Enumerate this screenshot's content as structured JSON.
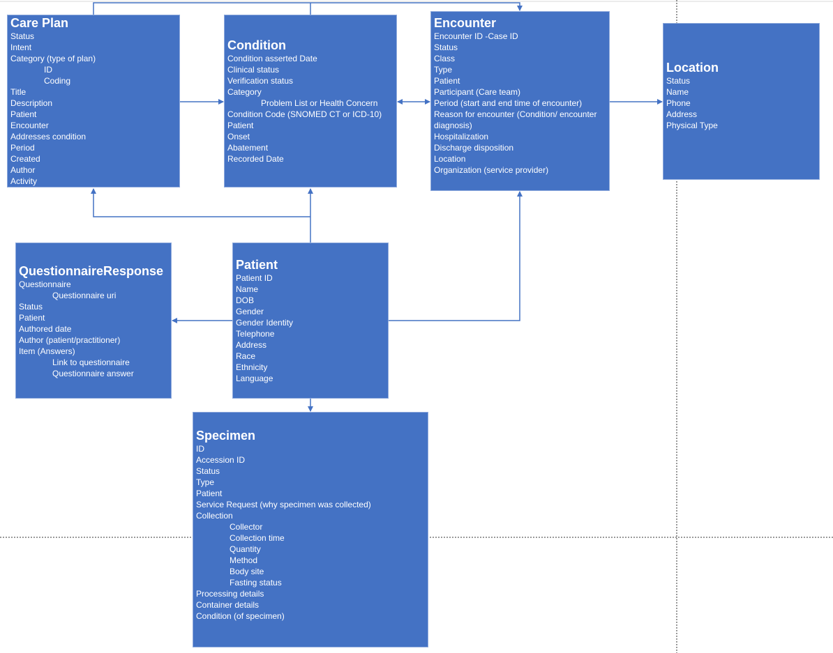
{
  "colors": {
    "box_fill": "#4472c4",
    "connector": "#4472c4"
  },
  "boxes": {
    "care_plan": {
      "title": "Care Plan",
      "items": [
        {
          "t": "Status"
        },
        {
          "t": "Intent"
        },
        {
          "t": "Category (type of plan)"
        },
        {
          "t": "ID",
          "sub": true
        },
        {
          "t": "Coding",
          "sub": true
        },
        {
          "t": "Title"
        },
        {
          "t": "Description"
        },
        {
          "t": "Patient"
        },
        {
          "t": "Encounter"
        },
        {
          "t": "Addresses condition"
        },
        {
          "t": "Period"
        },
        {
          "t": "Created"
        },
        {
          "t": "Author"
        },
        {
          "t": "Activity"
        }
      ]
    },
    "condition": {
      "title": "Condition",
      "items": [
        {
          "t": "Condition asserted Date"
        },
        {
          "t": "Clinical status"
        },
        {
          "t": "Verification status"
        },
        {
          "t": "Category"
        },
        {
          "t": "Problem List or Health Concern",
          "sub": true
        },
        {
          "t": "Condition Code (SNOMED CT or ICD-10)"
        },
        {
          "t": "Patient"
        },
        {
          "t": "Onset"
        },
        {
          "t": "Abatement"
        },
        {
          "t": "Recorded Date"
        }
      ]
    },
    "encounter": {
      "title": "Encounter",
      "items": [
        {
          "t": "Encounter ID -Case ID"
        },
        {
          "t": "Status"
        },
        {
          "t": "Class"
        },
        {
          "t": "Type"
        },
        {
          "t": "Patient"
        },
        {
          "t": "Participant (Care team)"
        },
        {
          "t": "Period (start and end time of encounter)"
        },
        {
          "t": "Reason for encounter (Condition/ encounter"
        },
        {
          "t": "diagnosis)"
        },
        {
          "t": "Hospitalization"
        },
        {
          "t": "Discharge disposition"
        },
        {
          "t": "Location"
        },
        {
          "t": "Organization (service provider)"
        }
      ]
    },
    "location": {
      "title": "Location",
      "items": [
        {
          "t": "Status"
        },
        {
          "t": "Name"
        },
        {
          "t": "Phone"
        },
        {
          "t": "Address"
        },
        {
          "t": "Physical Type"
        }
      ]
    },
    "questionnaire_response": {
      "title": "QuestionnaireResponse",
      "items": [
        {
          "t": "Questionnaire"
        },
        {
          "t": "Questionnaire uri",
          "sub": true
        },
        {
          "t": "Status"
        },
        {
          "t": "Patient"
        },
        {
          "t": "Authored date"
        },
        {
          "t": "Author (patient/practitioner)"
        },
        {
          "t": "Item (Answers)"
        },
        {
          "t": "Link to questionnaire",
          "sub": true
        },
        {
          "t": "Questionnaire answer",
          "sub": true
        }
      ]
    },
    "patient": {
      "title": "Patient",
      "items": [
        {
          "t": "Patient ID"
        },
        {
          "t": "Name"
        },
        {
          "t": "DOB"
        },
        {
          "t": "Gender"
        },
        {
          "t": "Gender Identity"
        },
        {
          "t": "Telephone"
        },
        {
          "t": "Address"
        },
        {
          "t": "Race"
        },
        {
          "t": "Ethnicity"
        },
        {
          "t": "Language"
        }
      ]
    },
    "specimen": {
      "title": "Specimen",
      "items": [
        {
          "t": "ID"
        },
        {
          "t": "Accession ID"
        },
        {
          "t": "Status"
        },
        {
          "t": "Type"
        },
        {
          "t": "Patient"
        },
        {
          "t": "Service Request (why specimen was collected)"
        },
        {
          "t": "Collection"
        },
        {
          "t": "Collector",
          "sub": true
        },
        {
          "t": "Collection time",
          "sub": true
        },
        {
          "t": "Quantity",
          "sub": true
        },
        {
          "t": "Method",
          "sub": true
        },
        {
          "t": "Body site",
          "sub": true
        },
        {
          "t": "Fasting status",
          "sub": true
        },
        {
          "t": "Processing details"
        },
        {
          "t": "Container details"
        },
        {
          "t": "Condition (of specimen)"
        }
      ]
    }
  }
}
